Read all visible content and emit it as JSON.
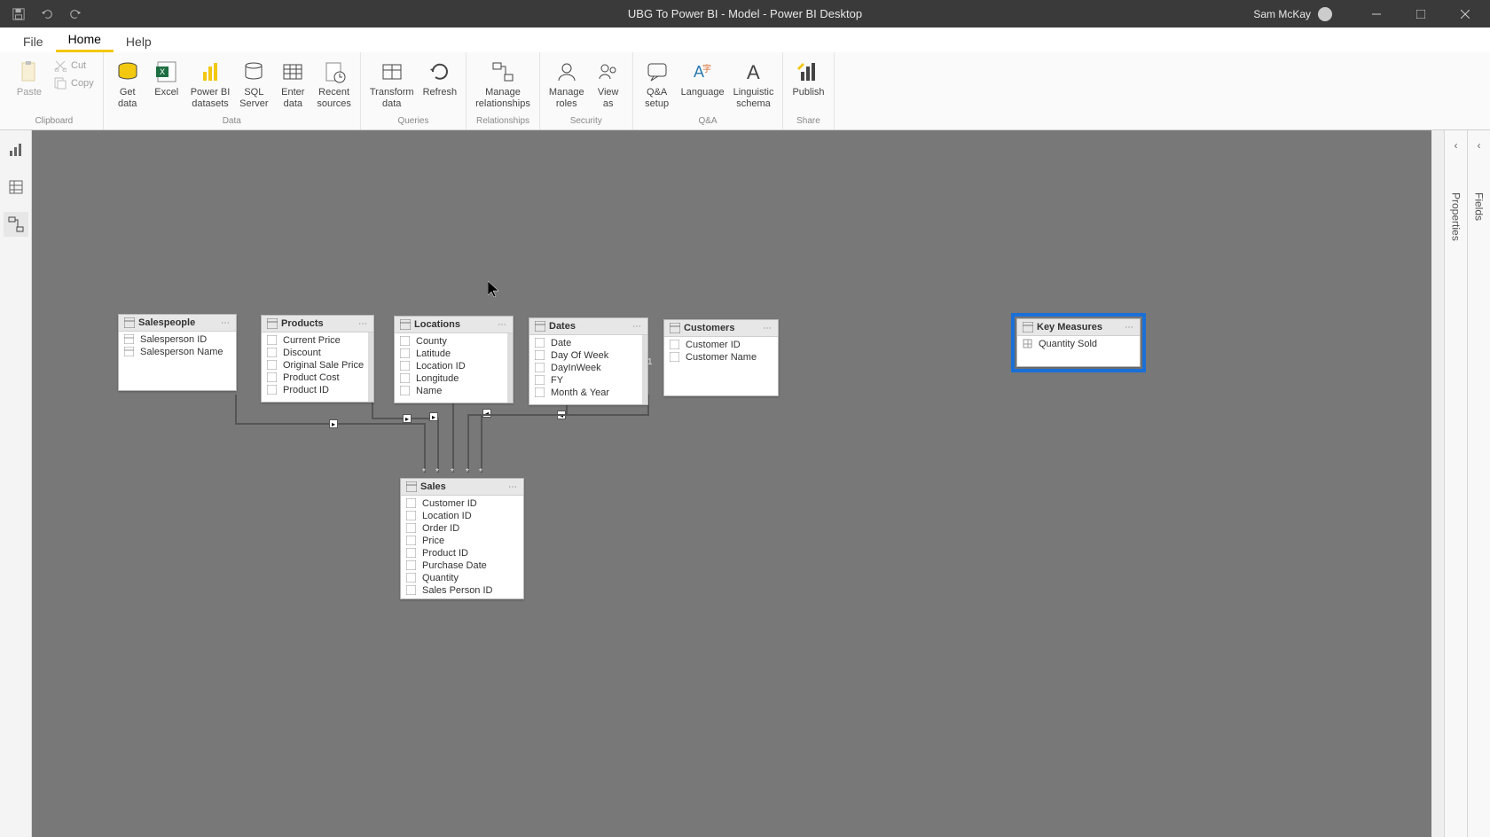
{
  "titlebar": {
    "app_title": "UBG To Power BI - Model - Power BI Desktop",
    "user": "Sam McKay"
  },
  "menu": {
    "file": "File",
    "home": "Home",
    "help": "Help"
  },
  "ribbon": {
    "clipboard": {
      "paste": "Paste",
      "cut": "Cut",
      "copy": "Copy",
      "label": "Clipboard"
    },
    "data": {
      "get_data": "Get\ndata",
      "excel": "Excel",
      "pbids": "Power BI\ndatasets",
      "sql": "SQL\nServer",
      "enter": "Enter\ndata",
      "recent": "Recent\nsources",
      "label": "Data"
    },
    "queries": {
      "transform": "Transform\ndata",
      "refresh": "Refresh",
      "label": "Queries"
    },
    "relationships": {
      "manage": "Manage\nrelationships",
      "label": "Relationships"
    },
    "security": {
      "roles": "Manage\nroles",
      "viewas": "View\nas",
      "label": "Security"
    },
    "qna": {
      "setup": "Q&A\nsetup",
      "language": "Language",
      "schema": "Linguistic\nschema",
      "label": "Q&A"
    },
    "share": {
      "publish": "Publish",
      "label": "Share"
    }
  },
  "rightrail": {
    "properties": "Properties",
    "fields": "Fields"
  },
  "tables": {
    "salespeople": {
      "name": "Salespeople",
      "fields": [
        "Salesperson ID",
        "Salesperson Name"
      ]
    },
    "products": {
      "name": "Products",
      "fields": [
        "Current Price",
        "Discount",
        "Original Sale Price",
        "Product Cost",
        "Product ID"
      ]
    },
    "locations": {
      "name": "Locations",
      "fields": [
        "County",
        "Latitude",
        "Location ID",
        "Longitude",
        "Name"
      ]
    },
    "dates": {
      "name": "Dates",
      "fields": [
        "Date",
        "Day Of Week",
        "DayInWeek",
        "FY",
        "Month & Year"
      ]
    },
    "customers": {
      "name": "Customers",
      "fields": [
        "Customer ID",
        "Customer Name"
      ]
    },
    "sales": {
      "name": "Sales",
      "fields": [
        "Customer ID",
        "Location ID",
        "Order ID",
        "Price",
        "Product ID",
        "Purchase Date",
        "Quantity",
        "Sales Person ID"
      ]
    },
    "keymeasures": {
      "name": "Key Measures",
      "fields": [
        "Quantity Sold"
      ]
    }
  },
  "rel_cardinality": {
    "one": "1",
    "many": "*"
  }
}
